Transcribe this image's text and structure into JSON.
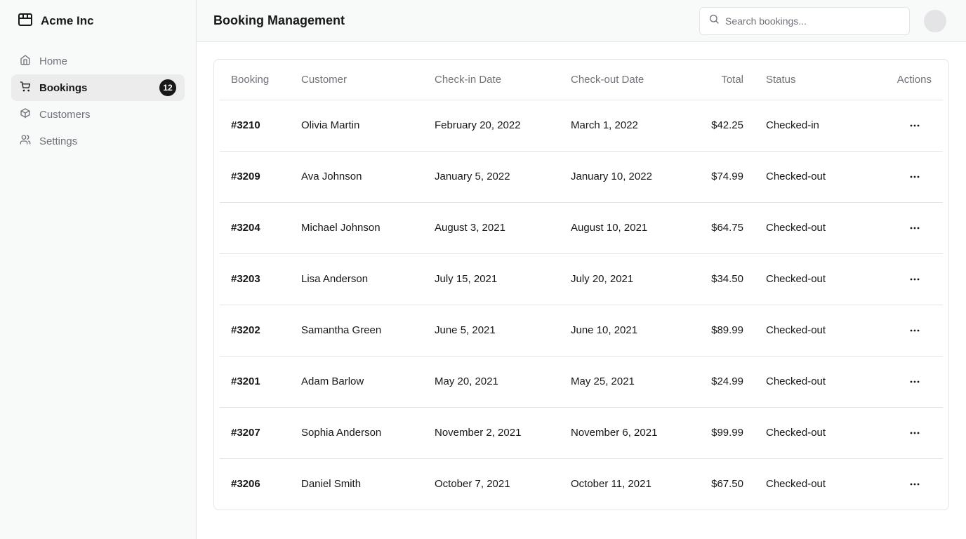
{
  "sidebar": {
    "brand": "Acme Inc",
    "items": [
      {
        "label": "Home",
        "icon": "home-icon"
      },
      {
        "label": "Bookings",
        "icon": "cart-icon",
        "badge": "12",
        "active": true
      },
      {
        "label": "Customers",
        "icon": "package-icon"
      },
      {
        "label": "Settings",
        "icon": "users-icon"
      }
    ]
  },
  "header": {
    "title": "Booking Management",
    "search_placeholder": "Search bookings..."
  },
  "table": {
    "columns": [
      "Booking",
      "Customer",
      "Check-in Date",
      "Check-out Date",
      "Total",
      "Status",
      "Actions"
    ],
    "rows": [
      {
        "booking": "#3210",
        "customer": "Olivia Martin",
        "checkin": "February 20, 2022",
        "checkout": "March 1, 2022",
        "total": "$42.25",
        "status": "Checked-in"
      },
      {
        "booking": "#3209",
        "customer": "Ava Johnson",
        "checkin": "January 5, 2022",
        "checkout": "January 10, 2022",
        "total": "$74.99",
        "status": "Checked-out"
      },
      {
        "booking": "#3204",
        "customer": "Michael Johnson",
        "checkin": "August 3, 2021",
        "checkout": "August 10, 2021",
        "total": "$64.75",
        "status": "Checked-out"
      },
      {
        "booking": "#3203",
        "customer": "Lisa Anderson",
        "checkin": "July 15, 2021",
        "checkout": "July 20, 2021",
        "total": "$34.50",
        "status": "Checked-out"
      },
      {
        "booking": "#3202",
        "customer": "Samantha Green",
        "checkin": "June 5, 2021",
        "checkout": "June 10, 2021",
        "total": "$89.99",
        "status": "Checked-out"
      },
      {
        "booking": "#3201",
        "customer": "Adam Barlow",
        "checkin": "May 20, 2021",
        "checkout": "May 25, 2021",
        "total": "$24.99",
        "status": "Checked-out"
      },
      {
        "booking": "#3207",
        "customer": "Sophia Anderson",
        "checkin": "November 2, 2021",
        "checkout": "November 6, 2021",
        "total": "$99.99",
        "status": "Checked-out"
      },
      {
        "booking": "#3206",
        "customer": "Daniel Smith",
        "checkin": "October 7, 2021",
        "checkout": "October 11, 2021",
        "total": "$67.50",
        "status": "Checked-out"
      }
    ]
  }
}
